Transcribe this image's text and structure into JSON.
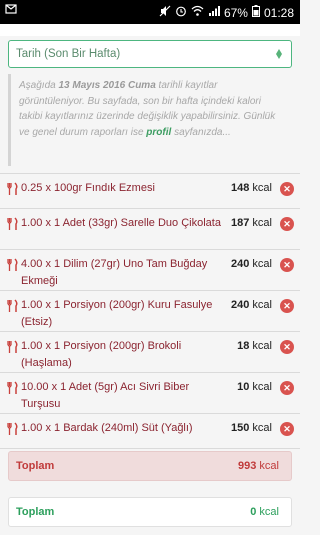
{
  "status_bar": {
    "battery": "67%",
    "time": "01:28",
    "icons": [
      "notification-icon",
      "mute-icon",
      "alarm-icon",
      "wifi-icon",
      "signal-icon",
      "battery-icon"
    ]
  },
  "period_select": {
    "value": "Tarih (Son Bir Hafta)",
    "icon": "chevron-down-icon"
  },
  "info": {
    "prefix": "Aşağıda ",
    "date": "13 Mayıs 2016 Cuma",
    "middle": " tarihli kayıtlar görüntüleniyor. Bu sayfada, son bir hafta içindeki kalori takibi kayıtlarınız üzerinde değişiklik yapabilirsiniz. Günlük ve genel durum raporları ise ",
    "link": "profil",
    "suffix": " sayfanızda..."
  },
  "entries": [
    {
      "food": "0.25 x 100gr Fındık Ezmesi",
      "kcal_value": "148",
      "kcal_unit": " kcal"
    },
    {
      "food": "1.00 x 1 Adet (33gr) Sarelle Duo Çikolata",
      "kcal_value": "187",
      "kcal_unit": " kcal"
    },
    {
      "food": "4.00 x 1 Dilim (27gr) Uno Tam Buğday Ekmeği",
      "kcal_value": "240",
      "kcal_unit": " kcal"
    },
    {
      "food": "1.00 x 1 Porsiyon (200gr) Kuru Fasulye (Etsiz)",
      "kcal_value": "240",
      "kcal_unit": " kcal"
    },
    {
      "food": "1.00 x 1 Porsiyon (200gr) Brokoli (Haşlama)",
      "kcal_value": "18",
      "kcal_unit": " kcal"
    },
    {
      "food": "10.00 x 1 Adet (5gr) Acı Sivri Biber Turşusu",
      "kcal_value": "10",
      "kcal_unit": " kcal"
    },
    {
      "food": "1.00 x 1 Bardak (240ml) Süt (Yağlı)",
      "kcal_value": "150",
      "kcal_unit": " kcal"
    }
  ],
  "total_consumed": {
    "label": "Toplam",
    "value": "993",
    "unit": " kcal"
  },
  "total_other": {
    "label": "Toplam",
    "value": "0",
    "unit": " kcal"
  },
  "colors": {
    "accent_green": "#2c9f5c",
    "food_text": "#8b2430",
    "delete": "#d9534f",
    "total_red_bg": "#f0dcdc"
  }
}
